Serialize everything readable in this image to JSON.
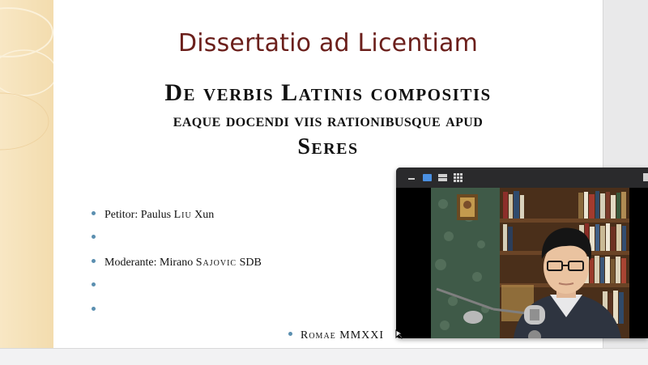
{
  "slide": {
    "title": "Dissertatio ad Licentiam",
    "subtitle_line1": "De verbis Latinis compositis",
    "subtitle_line2": "eaque docendi viis rationibusque apud",
    "subtitle_line3": "Seres",
    "bullets": [
      {
        "prefix": "Petitor: Paulus ",
        "smallcaps": "Liu",
        "suffix": " Xun"
      },
      {
        "prefix": "",
        "smallcaps": "",
        "suffix": ""
      },
      {
        "prefix": "Moderante: Mirano ",
        "smallcaps": "Sajovic",
        "suffix": " SDB"
      },
      {
        "prefix": "",
        "smallcaps": "",
        "suffix": ""
      },
      {
        "prefix": "",
        "smallcaps": "",
        "suffix": ""
      }
    ],
    "date_line": "Romae MMXXI",
    "colors": {
      "title": "#6b1f1b",
      "bullet": "#5b8fb0",
      "band": "#f3dcae"
    }
  },
  "video_window": {
    "toolbar_icons": [
      "minimize-icon",
      "speaker-view-icon",
      "side-by-side-icon",
      "gallery-view-icon"
    ],
    "active_icon": "speaker-view-icon"
  }
}
